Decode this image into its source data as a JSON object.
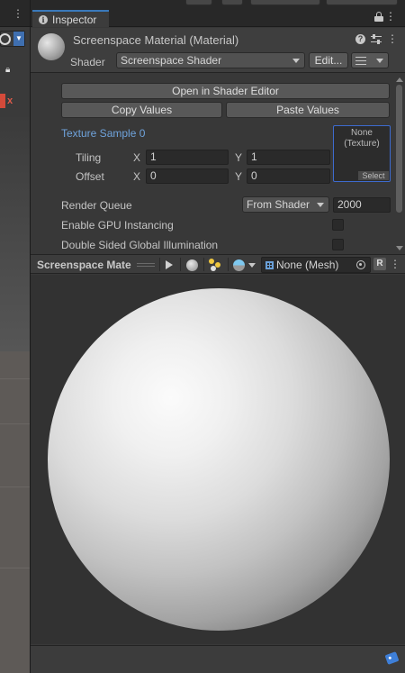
{
  "scene": {
    "menu_icon": "kebab-menu-icon",
    "gizmo_icon": "globe-gizmo-icon",
    "red_marker": "x"
  },
  "inspector": {
    "tab_label": "Inspector",
    "tab_icon": "info-icon",
    "lock_icon": "lock-icon",
    "menu_icon": "kebab-menu-icon"
  },
  "header": {
    "title": "Screenspace Material (Material)",
    "shader_label": "Shader",
    "shader_value": "Screenspace Shader",
    "edit_button": "Edit...",
    "list_menu_icon": "list-icon"
  },
  "properties": {
    "open_shader_editor": "Open in Shader Editor",
    "copy_values": "Copy Values",
    "paste_values": "Paste Values",
    "texture_label": "Texture Sample 0",
    "tiling_label": "Tiling",
    "offset_label": "Offset",
    "x_label": "X",
    "y_label": "Y",
    "tiling_x": "1",
    "tiling_y": "1",
    "offset_x": "0",
    "offset_y": "0",
    "texture_slot_none": "None",
    "texture_slot_type": "(Texture)",
    "texture_slot_select": "Select",
    "render_queue_label": "Render Queue",
    "render_queue_mode": "From Shader",
    "render_queue_value": "2000",
    "gpu_instancing_label": "Enable GPU Instancing",
    "double_sided_gi_label": "Double Sided Global Illumination"
  },
  "preview": {
    "title": "Screenspace Mate",
    "mesh_value": "None (Mesh)",
    "reset_button": "R"
  },
  "colors": {
    "accent": "#3a79bb",
    "texture_label": "#6fa3dc",
    "panel_bg": "#383838"
  }
}
